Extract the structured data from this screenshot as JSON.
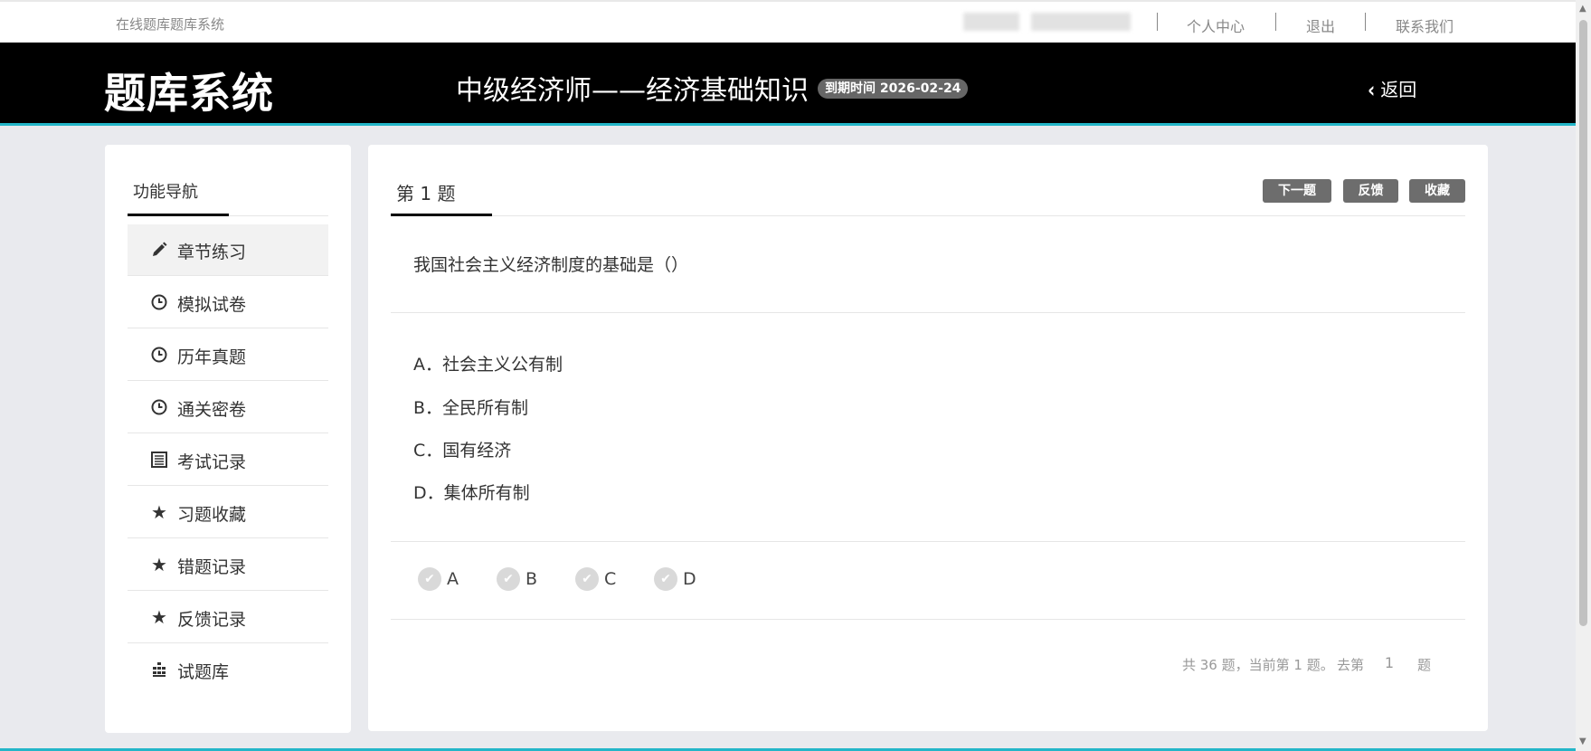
{
  "topbar": {
    "site_name": "在线题库题库系统",
    "links": [
      "个人中心",
      "退出",
      "联系我们"
    ]
  },
  "header": {
    "logo": "题库系统",
    "course_title": "中级经济师——经济基础知识",
    "expiry_badge": "到期时间 2026-02-24",
    "back_label": "返回"
  },
  "sidebar": {
    "title": "功能导航",
    "items": [
      {
        "label": "章节练习",
        "icon": "pencil-icon",
        "active": true
      },
      {
        "label": "模拟试卷",
        "icon": "clock-icon"
      },
      {
        "label": "历年真题",
        "icon": "clock-icon"
      },
      {
        "label": "通关密卷",
        "icon": "clock-icon"
      },
      {
        "label": "考试记录",
        "icon": "list-icon"
      },
      {
        "label": "习题收藏",
        "icon": "star-icon"
      },
      {
        "label": "错题记录",
        "icon": "star-icon"
      },
      {
        "label": "反馈记录",
        "icon": "star-icon"
      },
      {
        "label": "试题库",
        "icon": "bars-icon"
      }
    ]
  },
  "question": {
    "title": "第 1 题",
    "buttons": {
      "next": "下一题",
      "feedback": "反馈",
      "favorite": "收藏"
    },
    "stem": "我国社会主义经济制度的基础是（）",
    "options": [
      "A．社会主义公有制",
      "B．全民所有制",
      "C．国有经济",
      "D．集体所有制"
    ],
    "answers": [
      "A",
      "B",
      "C",
      "D"
    ],
    "footer": {
      "summary": "共 36 题，当前第 1 题。",
      "goto_prefix": "去第",
      "goto_value": "1",
      "goto_suffix": "题"
    }
  },
  "colors": {
    "accent": "#23b6c8",
    "header_bg": "#000000",
    "button_bg": "#6d6d6d"
  }
}
